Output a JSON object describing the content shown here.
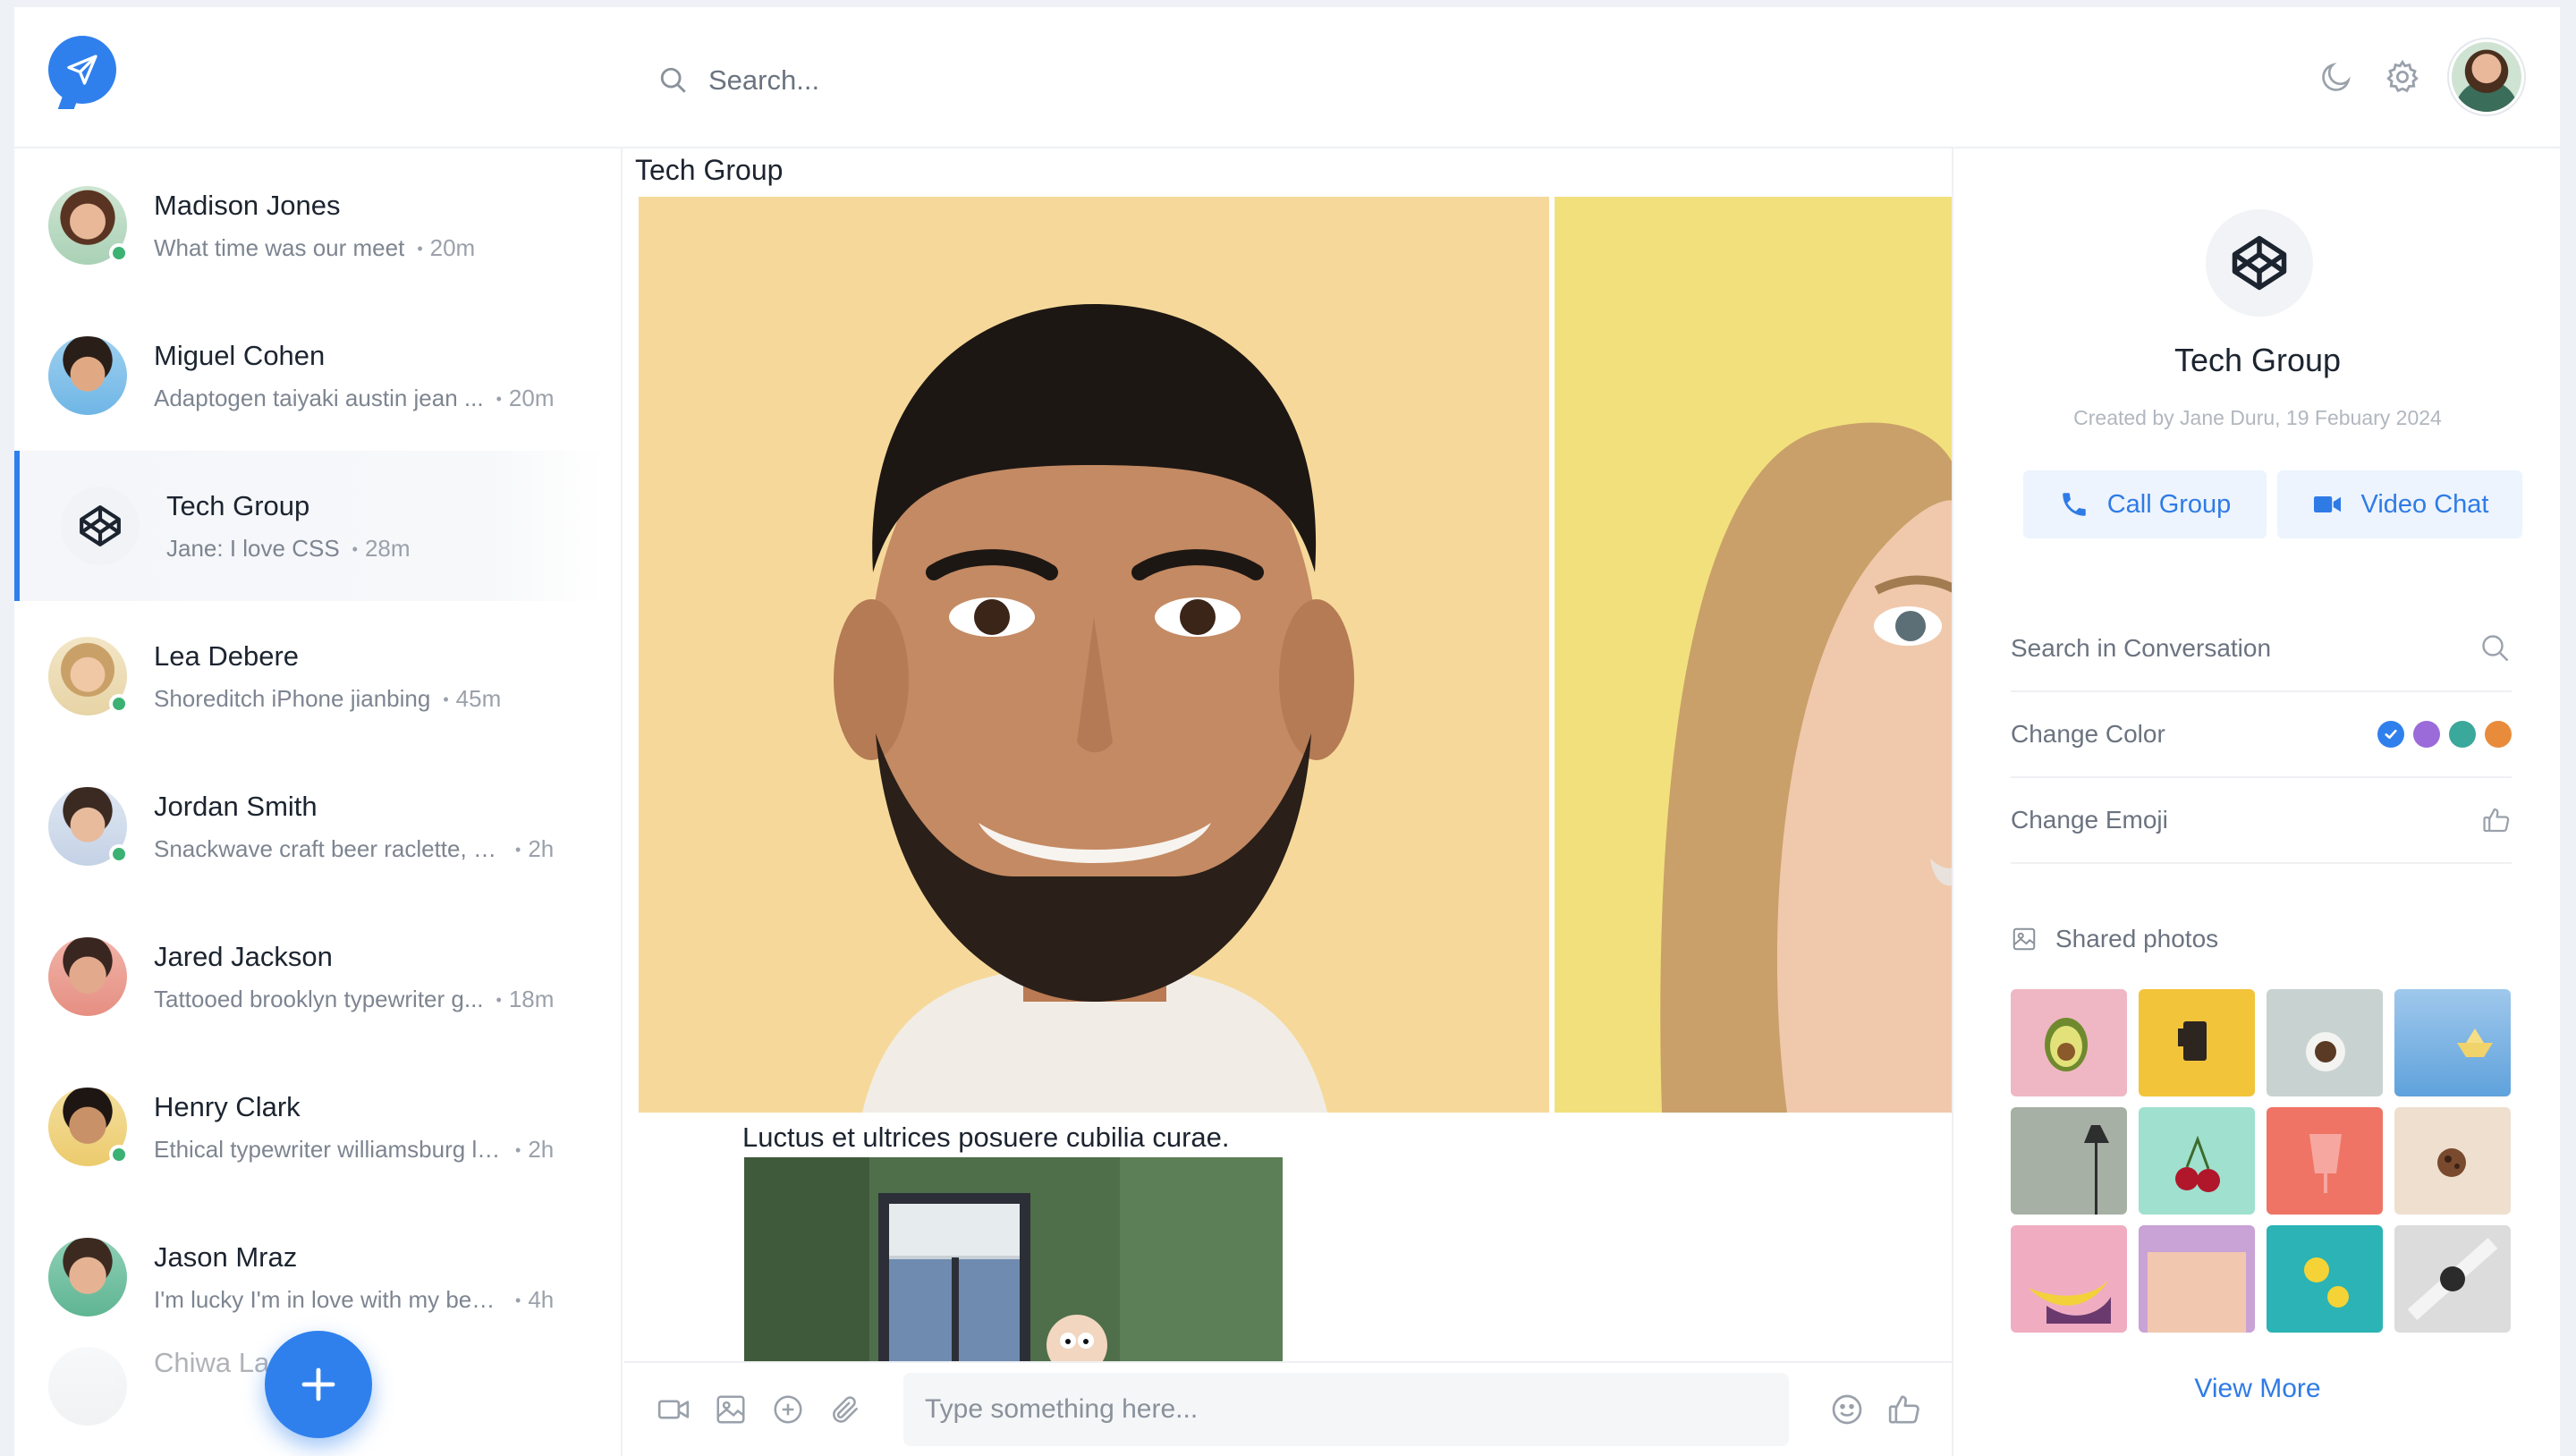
{
  "header": {
    "search_placeholder": "Search..."
  },
  "sidebar": {
    "chats": [
      {
        "name": "Madison Jones",
        "message": "What time was our meet",
        "time": "20m",
        "online": true
      },
      {
        "name": "Miguel Cohen",
        "message": "Adaptogen taiyaki austin jean ...",
        "time": "20m",
        "online": false
      },
      {
        "name": "Tech Group",
        "message": "Jane: I love CSS",
        "time": "28m",
        "online": false,
        "active": true
      },
      {
        "name": "Lea Debere",
        "message": "Shoreditch iPhone jianbing",
        "time": "45m",
        "online": true
      },
      {
        "name": "Jordan Smith",
        "message": "Snackwave craft beer raclette, b...",
        "time": "2h",
        "online": true
      },
      {
        "name": "Jared Jackson",
        "message": "Tattooed brooklyn typewriter g...",
        "time": "18m",
        "online": false
      },
      {
        "name": "Henry Clark",
        "message": "Ethical typewriter williamsburg lo...",
        "time": "2h",
        "online": true
      },
      {
        "name": "Jason Mraz",
        "message": "I'm lucky I'm in love with my best ...",
        "time": "4h",
        "online": false
      },
      {
        "name": "Chiwa La"
      }
    ]
  },
  "main": {
    "title": "Tech Group",
    "caption": "Luctus et ultrices posuere cubilia curae.",
    "composer_placeholder": "Type something here..."
  },
  "panel": {
    "group_name": "Tech Group",
    "created": "Created by Jane Duru, 19 Febuary 2024",
    "call_label": "Call Group",
    "video_label": "Video Chat",
    "search_label": "Search in Conversation",
    "color_label": "Change Color",
    "emoji_label": "Change Emoji",
    "shared_title": "Shared photos",
    "view_more": "View More",
    "colors": [
      "#2f80ed",
      "#9b6bd9",
      "#3aa89a",
      "#e88c3c"
    ]
  },
  "colors": {
    "accent": "#2f80ed",
    "online": "#3bb273"
  }
}
